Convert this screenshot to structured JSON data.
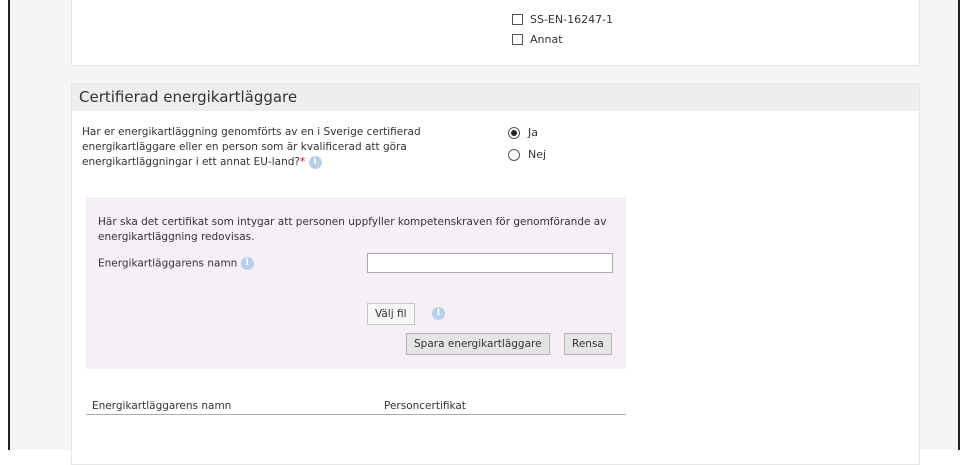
{
  "standards": {
    "options": [
      {
        "label": "SS-EN-16247-1",
        "checked": false
      },
      {
        "label": "Annat",
        "checked": false
      }
    ]
  },
  "section": {
    "title": "Certifierad energikartläggare",
    "question": "Har er energikartläggning genomförts av en i Sverige certifierad energikartläggare eller en person som är kvalificerad att göra energikartläggningar i ett annat EU-land?",
    "required_mark": "*",
    "info_icon": "info-icon",
    "answers": [
      {
        "label": "Ja",
        "selected": true
      },
      {
        "label": "Nej",
        "selected": false
      }
    ]
  },
  "certificate": {
    "description": "Här ska det certifikat som intygar att personen uppfyller kompetenskraven för genomförande av energikartläggning redovisas.",
    "name_label": "Energikartläggarens namn",
    "name_value": "",
    "choose_file_label": "Välj fil",
    "save_label": "Spara energikartläggare",
    "clear_label": "Rensa"
  },
  "table": {
    "columns": [
      "Energikartläggarens namn",
      "Personcertifikat"
    ]
  },
  "colors": {
    "background": "#f5f5f5",
    "header_bg": "#eeeeee",
    "certificate_bg": "#f7eff6",
    "info_icon": "#b6d0ec",
    "required": "#d9000d"
  }
}
